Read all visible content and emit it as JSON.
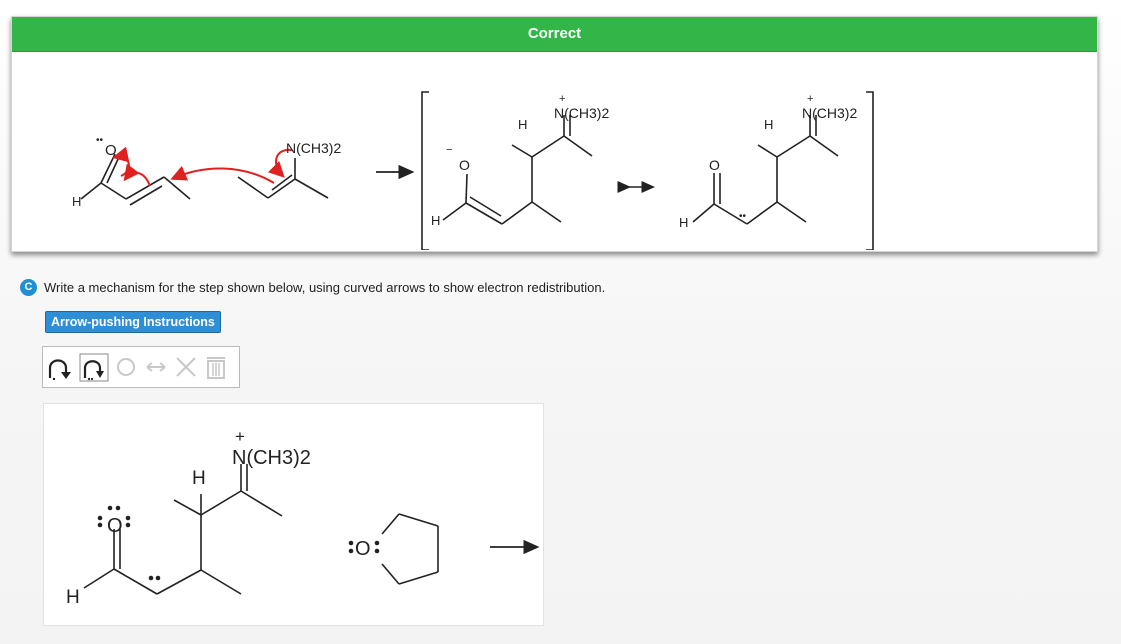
{
  "feedback": {
    "banner": "Correct",
    "labels": {
      "h": "H",
      "amine_group": "N(CH3)2",
      "iminium_group": "N(CH3)2",
      "plus": "+",
      "minus": "−",
      "oxygen": "O",
      "lone_pair": "••"
    }
  },
  "question": {
    "part": "C",
    "prompt": "Write a mechanism for the step shown below, using curved arrows to show electron redistribution.",
    "instructions_button": "Arrow-pushing Instructions"
  },
  "toolbar": {
    "tools": [
      {
        "name": "electron-pair-arrow",
        "icon": "curved-arrow-icon"
      },
      {
        "name": "single-electron-arrow",
        "icon": "half-curved-arrow-icon"
      },
      {
        "name": "rotate",
        "icon": "rotate-icon"
      },
      {
        "name": "resonance",
        "icon": "double-headed-arrow-icon"
      },
      {
        "name": "delete",
        "icon": "close-icon"
      },
      {
        "name": "clear-all",
        "icon": "trash-icon"
      }
    ]
  },
  "drawing": {
    "h_label": "H",
    "iminium_group": "N(CH3)2",
    "plus": "+",
    "oxygen": "O",
    "thf_oxygen": "O"
  }
}
